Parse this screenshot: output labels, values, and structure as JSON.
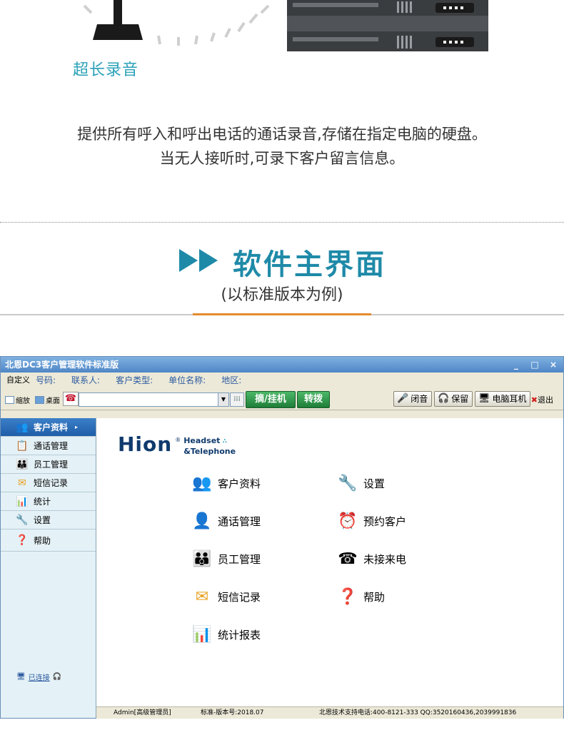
{
  "promo": {
    "feature_label": "超长录音",
    "desc_line1": "提供所有呼入和呼出电话的通话录音,存储在指定电脑的硬盘。",
    "desc_line2": "当无人接听时,可录下客户留言信息。"
  },
  "section": {
    "title": "软件主界面",
    "subtitle": "(以标准版本为例)"
  },
  "window": {
    "title": "北恩DC3客户管理软件标准版",
    "controls": [
      "_",
      "□",
      "×"
    ]
  },
  "filterbar": {
    "custom": "自定义",
    "fields": [
      "号码:",
      "联系人:",
      "客户类型:",
      "单位名称:",
      "地区:"
    ]
  },
  "toolbar": {
    "shrink": "缩放",
    "desktop": "桌面",
    "pickup_hangup": "摘/挂机",
    "transfer": "转拨",
    "mute": "闭音",
    "hold": "保留",
    "pc_headset": "电脑耳机",
    "exit": "退出"
  },
  "sidebar": {
    "items": [
      {
        "label": "客户资料",
        "icon": "customer-icon"
      },
      {
        "label": "通话管理",
        "icon": "call-icon"
      },
      {
        "label": "员工管理",
        "icon": "staff-icon"
      },
      {
        "label": "短信记录",
        "icon": "sms-icon"
      },
      {
        "label": "统计",
        "icon": "stats-icon"
      },
      {
        "label": "设置",
        "icon": "settings-icon"
      },
      {
        "label": "帮助",
        "icon": "help-icon"
      }
    ],
    "connection": "已连接"
  },
  "main": {
    "logo_text": "Hion",
    "logo_reg": "®",
    "logo_tag1": "Headset",
    "logo_tag2": "&Telephone",
    "menu": [
      {
        "label": "客户资料",
        "icon": "customer-icon"
      },
      {
        "label": "设置",
        "icon": "settings-icon"
      },
      {
        "label": "通话管理",
        "icon": "call-icon"
      },
      {
        "label": "预约客户",
        "icon": "alarm-clock-icon"
      },
      {
        "label": "员工管理",
        "icon": "staff-icon"
      },
      {
        "label": "未接来电",
        "icon": "missed-call-icon"
      },
      {
        "label": "短信记录",
        "icon": "sms-icon"
      },
      {
        "label": "帮助",
        "icon": "help-icon"
      },
      {
        "label": "统计报表",
        "icon": "stats-icon"
      }
    ]
  },
  "status": {
    "user": "Admin[高级管理员]",
    "version": "标准-版本号:2018.07",
    "support": "北恩技术支持电话:400-8121-333  QQ:3520160436,2039991836"
  },
  "colors": {
    "accent": "#1f8aa8",
    "rule_accent": "#e58b2c",
    "titlebar": "#4f86c6"
  }
}
